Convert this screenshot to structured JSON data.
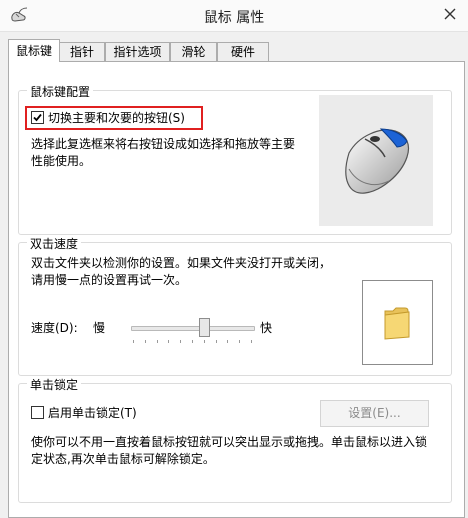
{
  "window": {
    "title": "鼠标 属性",
    "close_icon": "close-icon",
    "app_icon": "mouse-settings-icon"
  },
  "tabs": [
    {
      "label": "鼠标键",
      "active": true
    },
    {
      "label": "指针",
      "active": false
    },
    {
      "label": "指针选项",
      "active": false
    },
    {
      "label": "滑轮",
      "active": false
    },
    {
      "label": "硬件",
      "active": false
    }
  ],
  "button_config": {
    "title": "鼠标键配置",
    "switch_checkbox": {
      "label": "切换主要和次要的按钮(S)",
      "checked": true
    },
    "description": "选择此复选框来将右按钮设成如选择和拖放等主要性能使用。",
    "illustration": "mouse-illustration"
  },
  "double_click": {
    "title": "双击速度",
    "description": "双击文件夹以检测你的设置。如果文件夹没打开或关闭，请用慢一点的设置再试一次。",
    "speed_label": "速度(D):",
    "slow_label": "慢",
    "fast_label": "快",
    "speed_value": 0.6,
    "test_icon": "folder-icon"
  },
  "click_lock": {
    "title": "单击锁定",
    "enable_checkbox": {
      "label": "启用单击锁定(T)",
      "checked": false
    },
    "settings_button": "设置(E)...",
    "description": "使你可以不用一直按着鼠标按钮就可以突出显示或拖拽。单击鼠标以进入锁定状态,再次单击鼠标可解除锁定。"
  },
  "colors": {
    "highlight": "#e02020",
    "mouse_accent": "#1c63d6"
  }
}
